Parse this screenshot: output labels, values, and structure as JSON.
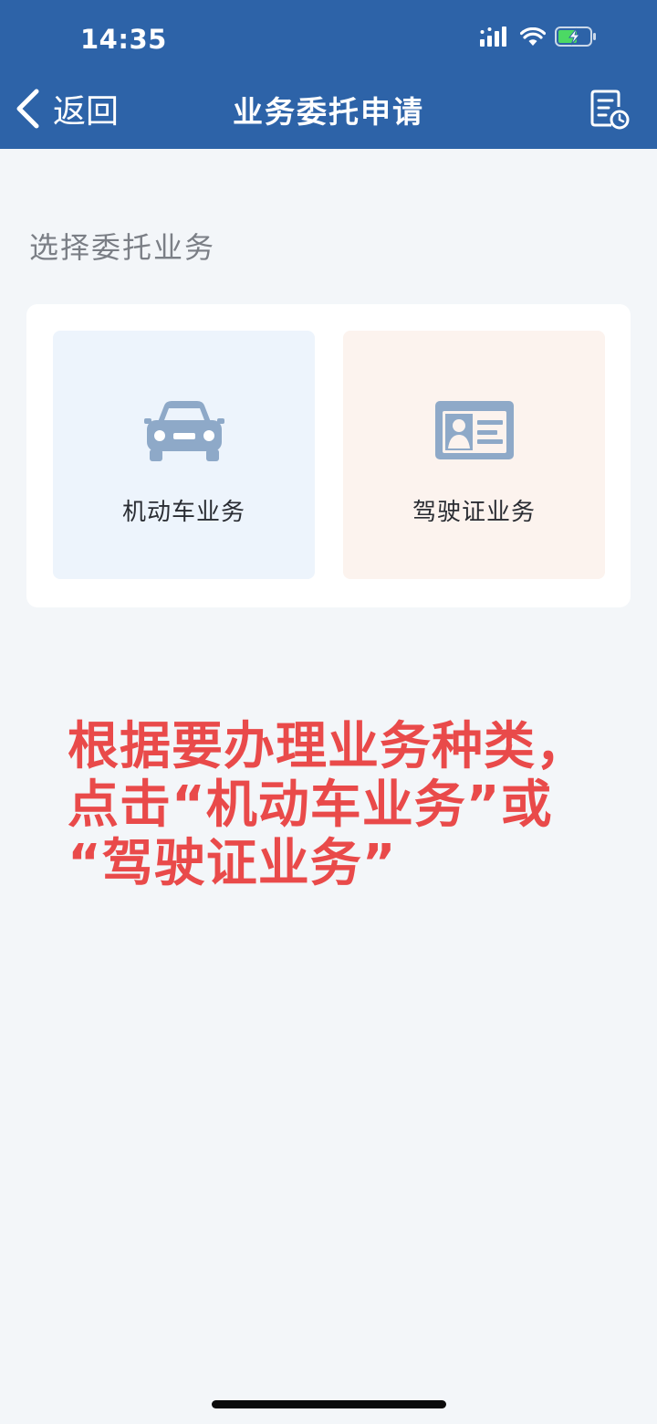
{
  "status_bar": {
    "time": "14:35",
    "icons": [
      "signal-icon",
      "wifi-icon",
      "battery-charging-icon"
    ]
  },
  "nav": {
    "back_label": "返回",
    "title": "业务委托申请",
    "right_icon": "record-history-icon"
  },
  "section_title": "选择委托业务",
  "services": [
    {
      "label": "机动车业务",
      "icon": "car-icon",
      "icon_color": "#8ea9c8",
      "tile_color": "#edf4fc"
    },
    {
      "label": "驾驶证业务",
      "icon": "id-card-icon",
      "icon_color": "#8ea9c8",
      "tile_color": "#fcf3ee"
    }
  ],
  "instruction": {
    "lines": [
      "根据要办理业务种类，",
      "点击“机动车业务”或",
      "“驾驶证业务”"
    ],
    "color": "#e94a4a"
  },
  "colors": {
    "header": "#2d63a8",
    "background": "#f3f6f9"
  }
}
